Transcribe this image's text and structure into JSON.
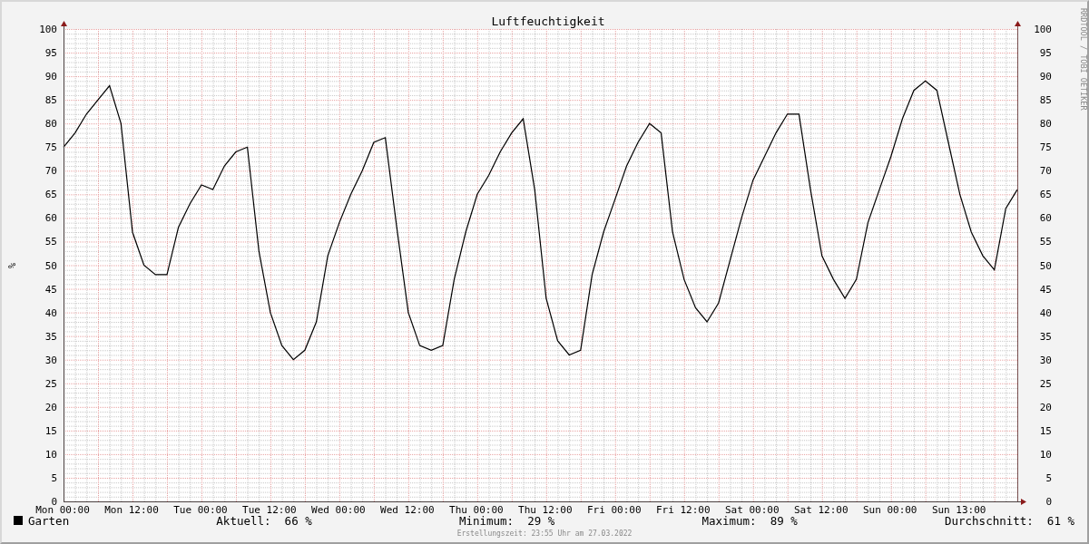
{
  "chart": {
    "watermark": "RRDTOOL / TOBI OETIKER",
    "right_axis_labels": [
      "100",
      "95",
      "90",
      "85",
      "80",
      "75",
      "70",
      "65",
      "60",
      "55",
      "50",
      "45",
      "40",
      "35",
      "30",
      "25",
      "20",
      "15",
      "10",
      "5",
      "0"
    ],
    "chart_data": {
      "type": "line",
      "title": "Luftfeuchtigkeit",
      "ylabel": "%",
      "categories": [
        "Mon 00:00",
        null,
        null,
        null,
        null,
        null,
        "Mon 12:00",
        null,
        null,
        null,
        null,
        null,
        "Tue 00:00",
        null,
        null,
        null,
        null,
        null,
        "Tue 12:00",
        null,
        null,
        null,
        null,
        null,
        "Wed 00:00",
        null,
        null,
        null,
        null,
        null,
        "Wed 12:00",
        null,
        null,
        null,
        null,
        null,
        "Thu 00:00",
        null,
        null,
        null,
        null,
        null,
        "Thu 12:00",
        null,
        null,
        null,
        null,
        null,
        "Fri 00:00",
        null,
        null,
        null,
        null,
        null,
        "Fri 12:00",
        null,
        null,
        null,
        null,
        null,
        "Sat 00:00",
        null,
        null,
        null,
        null,
        null,
        "Sat 12:00",
        null,
        null,
        null,
        null,
        null,
        "Sun 00:00",
        null,
        null,
        null,
        null,
        null,
        "Sun 13:00",
        null,
        null,
        null,
        null,
        null
      ],
      "series": [
        {
          "name": "Garten",
          "color": "#000000",
          "values": [
            75,
            78,
            82,
            85,
            88,
            80,
            57,
            50,
            48,
            48,
            58,
            63,
            67,
            66,
            71,
            74,
            75,
            53,
            40,
            33,
            30,
            32,
            38,
            52,
            59,
            65,
            70,
            76,
            77,
            58,
            40,
            33,
            32,
            33,
            47,
            57,
            65,
            69,
            74,
            78,
            81,
            66,
            43,
            34,
            31,
            32,
            48,
            57,
            64,
            71,
            76,
            80,
            78,
            57,
            47,
            41,
            38,
            42,
            51,
            60,
            68,
            73,
            78,
            82,
            82,
            66,
            52,
            47,
            43,
            47,
            59,
            66,
            73,
            81,
            87,
            89,
            87,
            76,
            65,
            57,
            52,
            49,
            62,
            66
          ]
        }
      ],
      "ylim": [
        0,
        100
      ],
      "grid": true,
      "yticks": [
        0,
        5,
        10,
        15,
        20,
        25,
        30,
        35,
        40,
        45,
        50,
        55,
        60,
        65,
        70,
        75,
        80,
        85,
        90,
        95,
        100
      ]
    }
  },
  "legend": {
    "stats": [
      {
        "label": "Aktuell:",
        "value": "66 %"
      },
      {
        "label": "Minimum:",
        "value": "29 %"
      },
      {
        "label": "Maximum:",
        "value": "89 %"
      },
      {
        "label": "Durchschnitt:",
        "value": "61 %"
      }
    ]
  },
  "footer": "Erstellungszeit: 23:55 Uhr am 27.03.2022"
}
